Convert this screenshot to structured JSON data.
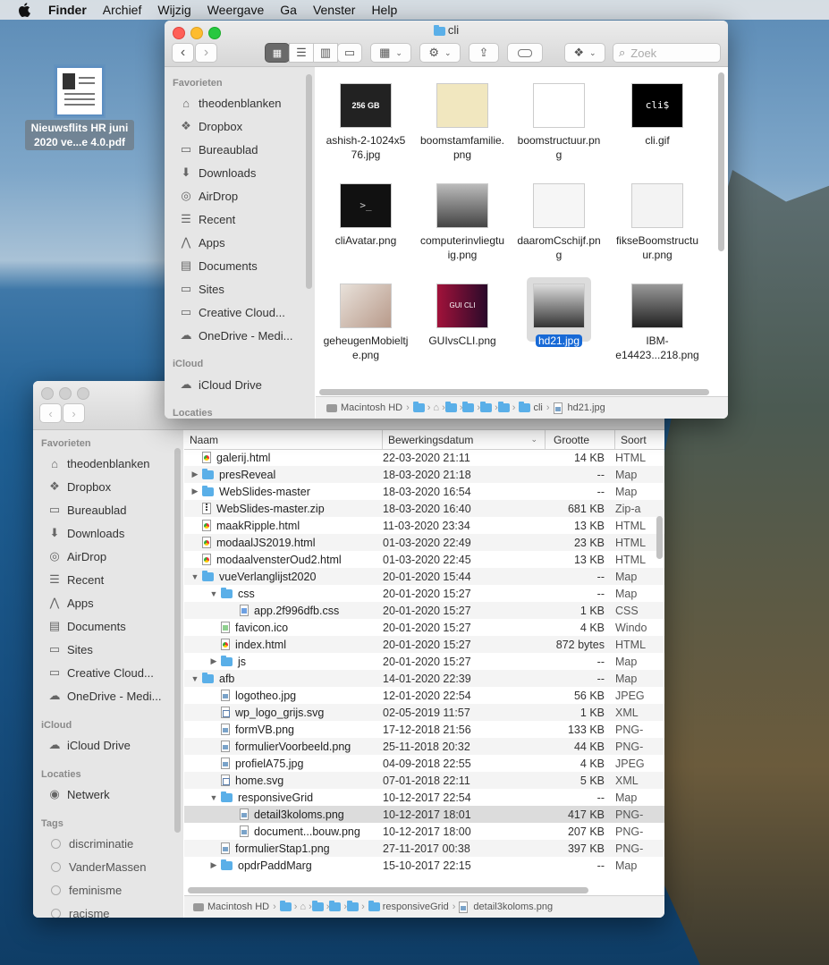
{
  "menubar": {
    "app_name": "Finder",
    "items": [
      "Archief",
      "Wijzig",
      "Weergave",
      "Ga",
      "Venster",
      "Help"
    ]
  },
  "desktop": {
    "file_label_line1": "Nieuwsflits HR juni",
    "file_label_line2": "2020 ve...e 4.0.pdf"
  },
  "window_top": {
    "title": "cli",
    "search_placeholder": "Zoek",
    "sidebar": {
      "favorites_header": "Favorieten",
      "favorites": [
        "theodenblanken",
        "Dropbox",
        "Bureaublad",
        "Downloads",
        "AirDrop",
        "Recent",
        "Apps",
        "Documents",
        "Sites",
        "Creative Cloud...",
        "OneDrive - Medi..."
      ],
      "icloud_header": "iCloud",
      "icloud": [
        "iCloud Drive"
      ],
      "locations_header": "Locaties"
    },
    "files": [
      {
        "name1": "ashish-2-1024x5",
        "name2": "76.jpg",
        "thumb_text": "256 GB",
        "selected": false
      },
      {
        "name1": "boomstamfamilie.",
        "name2": "png",
        "thumb_text": "",
        "selected": false
      },
      {
        "name1": "boomstructuur.pn",
        "name2": "g",
        "thumb_text": "",
        "selected": false
      },
      {
        "name1": "cli.gif",
        "name2": "",
        "thumb_text": "cli$",
        "selected": false
      },
      {
        "name1": "cliAvatar.png",
        "name2": "",
        "thumb_text": ">_",
        "selected": false
      },
      {
        "name1": "computerinvliegtu",
        "name2": "ig.png",
        "thumb_text": "",
        "selected": false
      },
      {
        "name1": "daaromCschijf.pn",
        "name2": "g",
        "thumb_text": "",
        "selected": false
      },
      {
        "name1": "fikseBoomstructu",
        "name2": "ur.png",
        "thumb_text": "",
        "selected": false
      },
      {
        "name1": "geheugenMobieltj",
        "name2": "e.png",
        "thumb_text": "",
        "selected": false
      },
      {
        "name1": "GUIvsCLI.png",
        "name2": "",
        "thumb_text": "GUI CLI",
        "selected": false
      },
      {
        "name1": "hd21.jpg",
        "name2": "",
        "thumb_text": "",
        "selected": true
      },
      {
        "name1": "IBM-",
        "name2": "e14423...218.png",
        "thumb_text": "",
        "selected": false
      }
    ],
    "path": [
      "Macintosh HD",
      "cli",
      "hd21.jpg"
    ]
  },
  "window_bottom": {
    "sidebar": {
      "favorites_header": "Favorieten",
      "favorites": [
        "theodenblanken",
        "Dropbox",
        "Bureaublad",
        "Downloads",
        "AirDrop",
        "Recent",
        "Apps",
        "Documents",
        "Sites",
        "Creative Cloud...",
        "OneDrive - Medi..."
      ],
      "icloud_header": "iCloud",
      "icloud": [
        "iCloud Drive"
      ],
      "locations_header": "Locaties",
      "locations": [
        "Netwerk"
      ],
      "tags_header": "Tags",
      "tags": [
        "discriminatie",
        "VanderMassen",
        "feminisme",
        "racisme"
      ]
    },
    "columns": {
      "name": "Naam",
      "date": "Bewerkingsdatum",
      "size": "Grootte",
      "kind": "Soort"
    },
    "rows": [
      {
        "name": "galerij.html",
        "date": "22-03-2020 21:11",
        "size": "14 KB",
        "kind": "HTML",
        "level": 0,
        "type": "html",
        "disc": ""
      },
      {
        "name": "presReveal",
        "date": "18-03-2020 21:18",
        "size": "--",
        "kind": "Map",
        "level": 0,
        "type": "folder",
        "disc": "▶"
      },
      {
        "name": "WebSlides-master",
        "date": "18-03-2020 16:54",
        "size": "--",
        "kind": "Map",
        "level": 0,
        "type": "folder",
        "disc": "▶"
      },
      {
        "name": "WebSlides-master.zip",
        "date": "18-03-2020 16:40",
        "size": "681 KB",
        "kind": "Zip-a",
        "level": 0,
        "type": "zip",
        "disc": ""
      },
      {
        "name": "maakRipple.html",
        "date": "11-03-2020 23:34",
        "size": "13 KB",
        "kind": "HTML",
        "level": 0,
        "type": "html",
        "disc": ""
      },
      {
        "name": "modaalJS2019.html",
        "date": "01-03-2020 22:49",
        "size": "23 KB",
        "kind": "HTML",
        "level": 0,
        "type": "html",
        "disc": ""
      },
      {
        "name": "modaalvensterOud2.html",
        "date": "01-03-2020 22:45",
        "size": "13 KB",
        "kind": "HTML",
        "level": 0,
        "type": "html",
        "disc": ""
      },
      {
        "name": "vueVerlanglijst2020",
        "date": "20-01-2020 15:44",
        "size": "--",
        "kind": "Map",
        "level": 0,
        "type": "folder",
        "disc": "▼"
      },
      {
        "name": "css",
        "date": "20-01-2020 15:27",
        "size": "--",
        "kind": "Map",
        "level": 1,
        "type": "folder",
        "disc": "▼"
      },
      {
        "name": "app.2f996dfb.css",
        "date": "20-01-2020 15:27",
        "size": "1 KB",
        "kind": "CSS",
        "level": 2,
        "type": "css",
        "disc": ""
      },
      {
        "name": "favicon.ico",
        "date": "20-01-2020 15:27",
        "size": "4 KB",
        "kind": "Windo",
        "level": 1,
        "type": "ico",
        "disc": ""
      },
      {
        "name": "index.html",
        "date": "20-01-2020 15:27",
        "size": "872 bytes",
        "kind": "HTML",
        "level": 1,
        "type": "html",
        "disc": ""
      },
      {
        "name": "js",
        "date": "20-01-2020 15:27",
        "size": "--",
        "kind": "Map",
        "level": 1,
        "type": "folder",
        "disc": "▶"
      },
      {
        "name": "afb",
        "date": "14-01-2020 22:39",
        "size": "--",
        "kind": "Map",
        "level": 0,
        "type": "folder",
        "disc": "▼"
      },
      {
        "name": "logotheo.jpg",
        "date": "12-01-2020 22:54",
        "size": "56 KB",
        "kind": "JPEG",
        "level": 1,
        "type": "img",
        "disc": ""
      },
      {
        "name": "wp_logo_grijs.svg",
        "date": "02-05-2019 11:57",
        "size": "1 KB",
        "kind": "XML",
        "level": 1,
        "type": "svg",
        "disc": ""
      },
      {
        "name": "formVB.png",
        "date": "17-12-2018 21:56",
        "size": "133 KB",
        "kind": "PNG-",
        "level": 1,
        "type": "img",
        "disc": ""
      },
      {
        "name": "formulierVoorbeeld.png",
        "date": "25-11-2018 20:32",
        "size": "44 KB",
        "kind": "PNG-",
        "level": 1,
        "type": "img",
        "disc": ""
      },
      {
        "name": "profielA75.jpg",
        "date": "04-09-2018 22:55",
        "size": "4 KB",
        "kind": "JPEG",
        "level": 1,
        "type": "img",
        "disc": ""
      },
      {
        "name": "home.svg",
        "date": "07-01-2018 22:11",
        "size": "5 KB",
        "kind": "XML",
        "level": 1,
        "type": "svg",
        "disc": ""
      },
      {
        "name": "responsiveGrid",
        "date": "10-12-2017 22:54",
        "size": "--",
        "kind": "Map",
        "level": 1,
        "type": "folder",
        "disc": "▼"
      },
      {
        "name": "detail3koloms.png",
        "date": "10-12-2017 18:01",
        "size": "417 KB",
        "kind": "PNG-",
        "level": 2,
        "type": "img",
        "disc": "",
        "selected": true
      },
      {
        "name": "document...bouw.png",
        "date": "10-12-2017 18:00",
        "size": "207 KB",
        "kind": "PNG-",
        "level": 2,
        "type": "img",
        "disc": ""
      },
      {
        "name": "formulierStap1.png",
        "date": "27-11-2017 00:38",
        "size": "397 KB",
        "kind": "PNG-",
        "level": 1,
        "type": "img",
        "disc": ""
      },
      {
        "name": "opdrPaddMarg",
        "date": "15-10-2017 22:15",
        "size": "--",
        "kind": "Map",
        "level": 1,
        "type": "folder",
        "disc": "▶"
      }
    ],
    "path": [
      "Macintosh HD",
      "responsiveGrid",
      "detail3koloms.png"
    ]
  }
}
